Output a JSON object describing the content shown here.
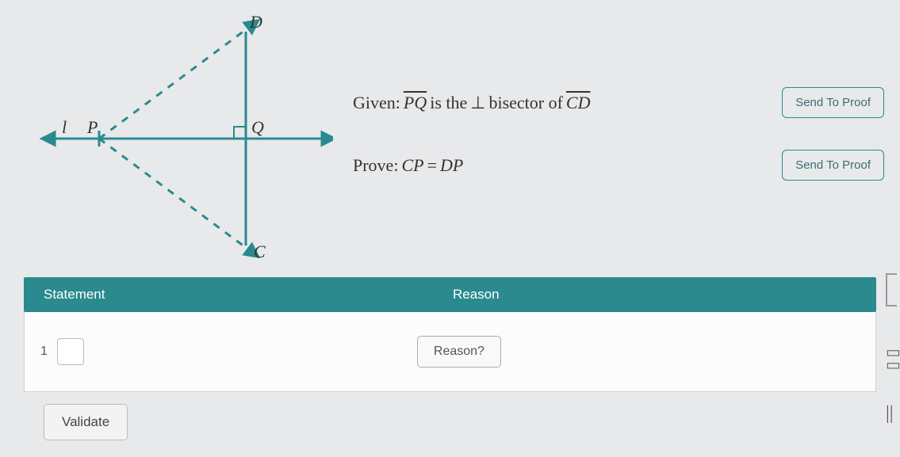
{
  "figure": {
    "points": {
      "D": "D",
      "Q": "Q",
      "C": "C",
      "P": "P",
      "l": "l"
    }
  },
  "problem": {
    "given_prefix": "Given: ",
    "given_seg": "PQ",
    "given_mid": " is the ",
    "given_perp": "⊥",
    "given_mid2": " bisector of ",
    "given_seg2": "CD",
    "prove_prefix": "Prove: ",
    "prove_expr_left": "CP",
    "prove_eq": " = ",
    "prove_expr_right": "DP",
    "send_btn1": "Send To Proof",
    "send_btn2": "Send To Proof"
  },
  "table": {
    "header_statement": "Statement",
    "header_reason": "Reason",
    "row1_num": "1",
    "reason_btn": "Reason?"
  },
  "validate_label": "Validate",
  "edge": {
    "parallel": "||"
  }
}
